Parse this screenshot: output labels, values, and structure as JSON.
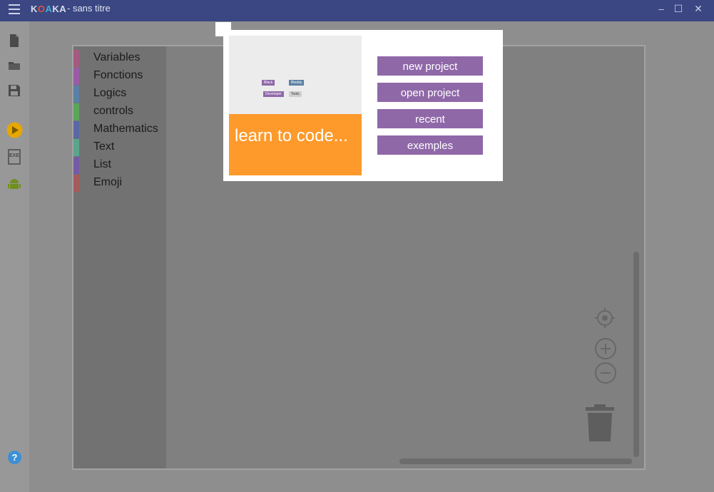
{
  "app": {
    "logo_letters": [
      "K",
      "O",
      "A",
      "K",
      "A"
    ],
    "title": "- sans titre"
  },
  "window_controls": [
    "–",
    "☐",
    "✕"
  ],
  "left_toolbar": {
    "items": [
      "new-file-icon",
      "open-folder-icon",
      "save-icon",
      "run-icon",
      "exe-icon",
      "android-icon",
      "help-icon"
    ],
    "exe_label": "EXE",
    "help_label": "?"
  },
  "toolbox": {
    "categories": [
      {
        "label": "Variables",
        "color": "#a55b80"
      },
      {
        "label": "Fonctions",
        "color": "#995ba5"
      },
      {
        "label": "Logics",
        "color": "#5b80a5"
      },
      {
        "label": "controls",
        "color": "#5ba55b"
      },
      {
        "label": "Mathematics",
        "color": "#5b67a5"
      },
      {
        "label": "Text",
        "color": "#5ba58c"
      },
      {
        "label": "List",
        "color": "#745ba5"
      },
      {
        "label": "Emoji",
        "color": "#a55b5b"
      }
    ]
  },
  "modal": {
    "learn_text": "learn to code...",
    "preview_blocks": [
      "Black",
      "Bloddy",
      "Developer",
      "Tools"
    ],
    "buttons": {
      "new_project": "new project",
      "open_project": "open project",
      "recent": "recent",
      "examples": "exemples"
    },
    "colors": {
      "accent": "#8f68a8",
      "learn": "#fd9a2b"
    }
  },
  "workspace_controls": [
    "recenter-icon",
    "zoom-in-icon",
    "zoom-out-icon",
    "trash-icon"
  ],
  "colors": {
    "titlebar": "#3a4783"
  }
}
